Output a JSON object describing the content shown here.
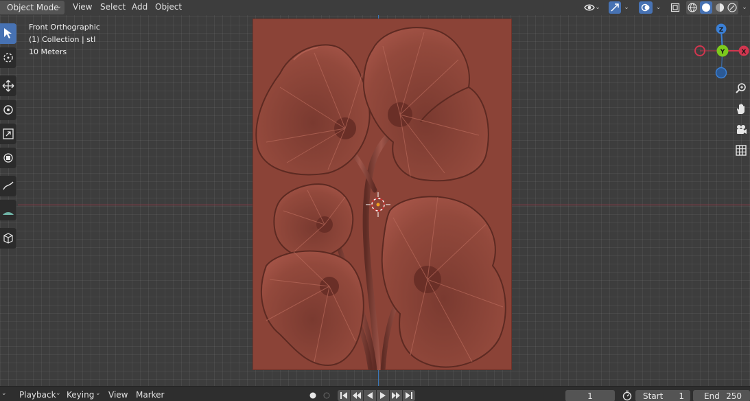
{
  "header": {
    "mode": "Object Mode",
    "menus": [
      "View",
      "Select",
      "Add",
      "Object"
    ]
  },
  "overlay": {
    "view_name": "Front Orthographic",
    "collection": "(1) Collection | stl",
    "scale": "10 Meters"
  },
  "gizmo": {
    "z_label": "Z",
    "y_label": "Y",
    "x_label": "X"
  },
  "timeline": {
    "menus": [
      "Playback",
      "Keying",
      "View",
      "Marker"
    ],
    "current_frame": "1",
    "start_label": "Start",
    "start_value": "1",
    "end_label": "End",
    "end_value": "250"
  },
  "colors": {
    "accent": "#4772b3",
    "x_axis": "#d1364f",
    "y_axis": "#7ccb1c",
    "z_axis": "#3b80d6",
    "model": "#8a4237"
  }
}
